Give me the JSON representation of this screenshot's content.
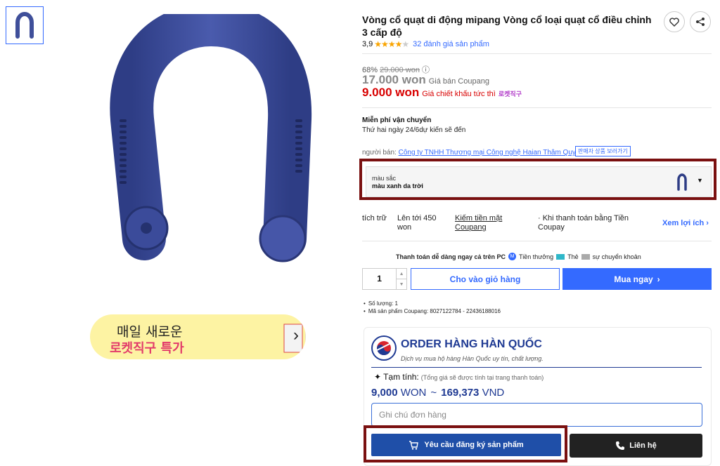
{
  "product": {
    "title": "Vòng cổ quạt di động mipang Vòng cổ loại quạt cổ điều chỉnh 3 cấp độ",
    "rating_value": "3,9",
    "review_count_text": "32 đánh giá sản phẩm",
    "discount_pct": "68%",
    "original_price": "29.000 won",
    "info_icon": "info-icon",
    "coupang_price": "17.000 won",
    "coupang_price_label": "Giá bán Coupang",
    "instant_price": "9.000 won",
    "instant_price_label": "Giá chiết khấu tức thì",
    "rocket_badge": "로켓직구"
  },
  "shipping": {
    "title": "Miễn phí vận chuyển",
    "date": "Thứ hai ngày 24/6dự kiến sẽ đến"
  },
  "seller": {
    "label": "người bán:",
    "name": "Công ty TNHH Thương mại Công nghệ Haian Thâm Quyến",
    "report_label": "판매자 상품 보러가기"
  },
  "option": {
    "key": "màu sắc",
    "value": "màu xanh da trời",
    "caret": "▼"
  },
  "cashback": {
    "col1": "tích trữ",
    "col2": "Lên tới 450 won",
    "col3": "Kiếm tiền mặt Coupang",
    "col4": "· Khi thanh toán bằng Tiền Coupay",
    "col5": "Xem lợi ích ›"
  },
  "payment": {
    "lead": "Thanh toán dễ dàng ngay cả trên PC",
    "m_icon": "M",
    "opt1": "Tiền thưởng",
    "opt2": "Thẻ",
    "opt3": "sự chuyển khoản"
  },
  "purchase": {
    "quantity": "1",
    "spin_up": "▲",
    "spin_down": "▼",
    "cart_label": "Cho vào giỏ hàng",
    "buy_label": "Mua ngay",
    "buy_arrow": "›"
  },
  "notes": [
    "Số lượng: 1",
    "Mã sản phẩm Coupang: 8027122784 - 22436188016"
  ],
  "promo": {
    "line1": "매일 새로운",
    "line2": "로켓직구 특가",
    "arrow": "›"
  },
  "order": {
    "title": "ORDER HÀNG HÀN QUỐC",
    "subtitle": "Dịch vụ mua hộ hàng Hàn Quốc uy tín, chất lượng.",
    "est_label": "Tạm tính:",
    "est_note": "(Tổng giá sẽ được tính tại trang thanh toán)",
    "won_value": "9,000",
    "won_unit": "WON",
    "tilde": "~",
    "vnd_value": "169,373",
    "vnd_unit": "VND",
    "note_placeholder": "Ghi chú đơn hàng",
    "request_label": "Yêu cầu đăng ký sản phẩm",
    "contact_label": "Liên hệ"
  },
  "colors": {
    "coupang_blue": "#346aff",
    "price_red": "#d80000",
    "order_navy": "#1f3a93",
    "highlight_border": "#7a1010",
    "product_blue": "#3f4f9a"
  }
}
